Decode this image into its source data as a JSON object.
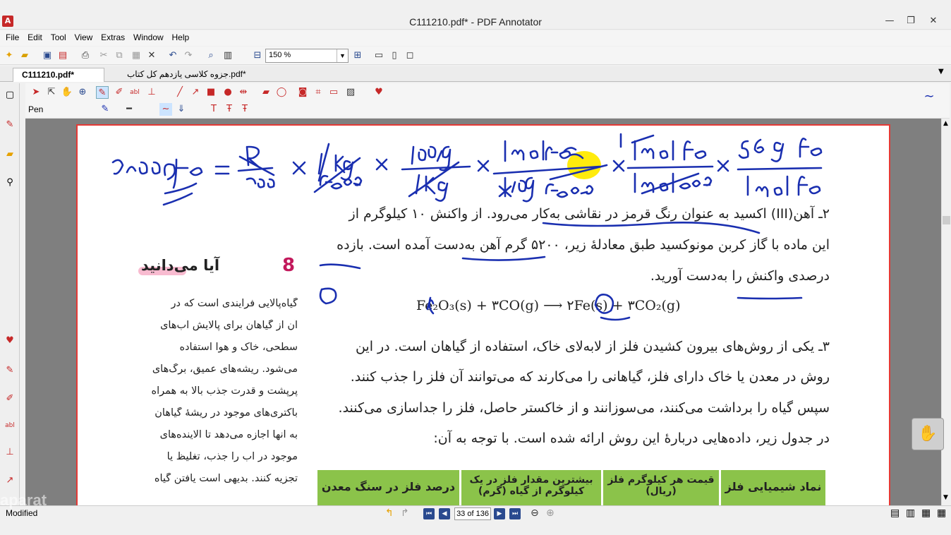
{
  "window": {
    "title": "C111210.pdf* - PDF Annotator",
    "app_icon": "pdf-annotator-logo"
  },
  "menu": [
    "File",
    "Edit",
    "Tool",
    "View",
    "Extras",
    "Window",
    "Help"
  ],
  "toolbar": {
    "zoom": "150 %"
  },
  "tabs": [
    {
      "label": "C111210.pdf*",
      "active": true
    },
    {
      "label": "جزوه کلاسی یازدهم کل کتاب.pdf*",
      "active": false
    }
  ],
  "annot_toolbar": {
    "current_tool_label": "Pen",
    "accent": "#c62828"
  },
  "document": {
    "lines": [
      "۲ـ آهن(III) اکسید به عنوان رنگ قرمز در نقاشی به‌کار می‌رود. از واکنش ۱۰ کیلوگرم از",
      "این ماده با گاز کربن مونوکسید طبق معادلهٔ زیر، ۵۲۰۰ گرم آهن به‌دست آمده است. بازده",
      "درصدی واکنش را به‌دست آورید.",
      "۳ـ یکی از روش‌های بیرون کشیدن فلز از لابه‌لای خاک، استفاده از گیاهان است. در این",
      "روش در معدن یا خاک دارای فلز، گیاهانی را می‌کارند که می‌توانند آن فلز را جذب کنند.",
      "سپس گیاه را برداشت می‌کنند، می‌سوزانند و از خاکستر حاصل، فلز را جداسازی می‌کنند.",
      "در جدول زیر، داده‌هایی دربارهٔ این روش ارائه شده است. با توجه به آن:"
    ],
    "equation": "Fe₂O₃(s) + ۳CO(g) ⟶ ۲Fe(s) + ۳CO₂(g)",
    "sidebox": {
      "number": "8",
      "title": "آیا می‌دانید",
      "lines": [
        "گیاه‌پالایی فرایندی است که در",
        "آن از گیاهان برای پالایش آب‌های",
        "سطحی، خاک و هوا استفاده",
        "می‌شود. ریشه‌های عمیق، برگ‌های",
        "پرپشت و قدرت جذب بالا به همراه",
        "باکتری‌های موجود در ریشهٔ گیاهان",
        "به آنها اجازه می‌دهد تا آلاینده‌های",
        "موجود در آب را جذب، تغلیظ یا",
        "تجزیه کنند. بدیهی است یافتن گیاه"
      ]
    },
    "table_headers": [
      "نماد شیمیایی فلز",
      "قیمت هر کیلوگرم فلز (ریال)",
      "بیشترین مقدار فلز در یک کیلوگرم از گیاه (گرم)",
      "درصد فلز در سنگ معدن"
    ],
    "table_color": "#8bc34a",
    "ink_color": "#1a2fb0",
    "highlight_color": "#ffea00"
  },
  "status": {
    "text": "Modified",
    "page": "33 of 136",
    "watermark": "aparat"
  }
}
